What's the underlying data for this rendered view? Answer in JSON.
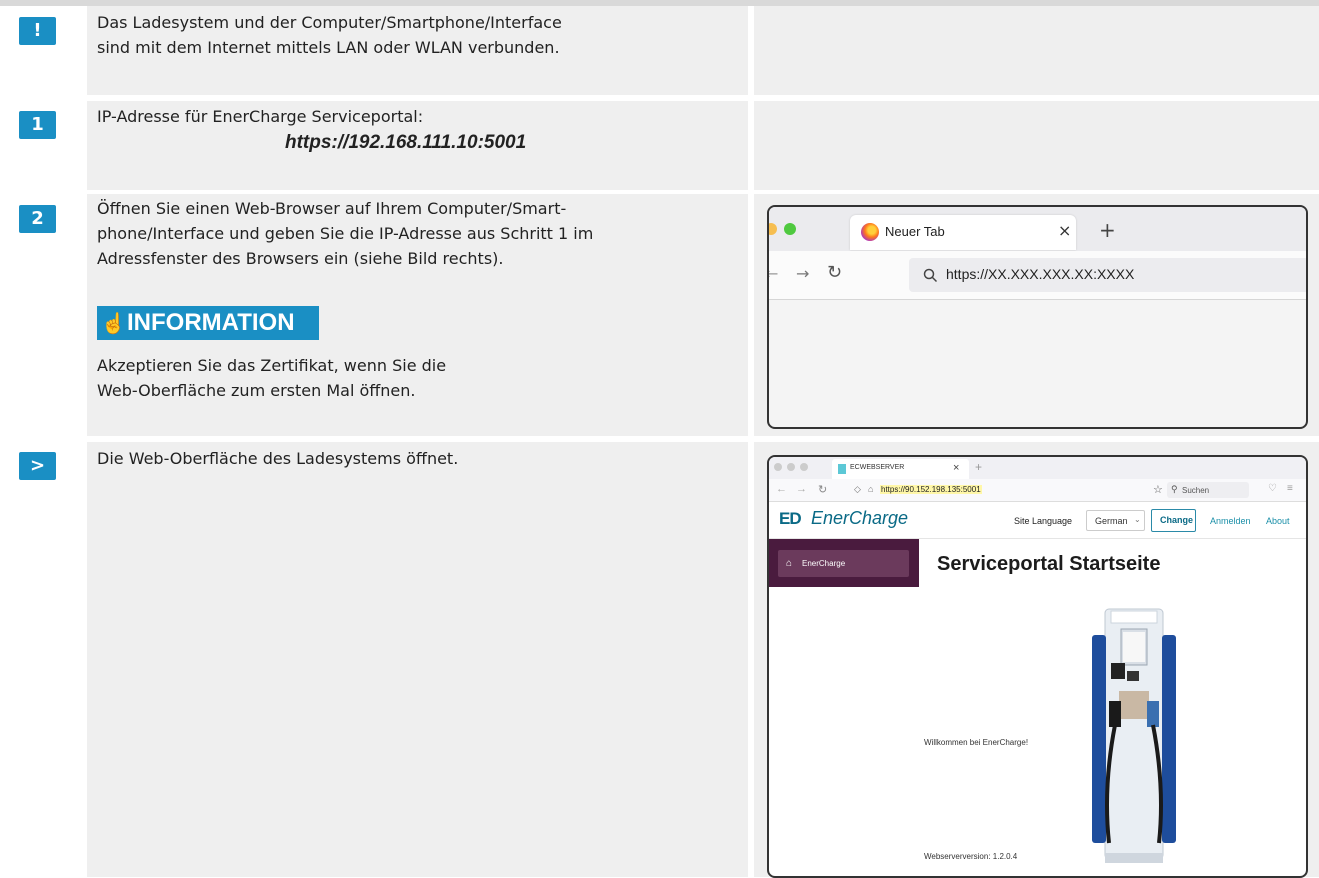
{
  "rows": [
    {
      "badge": "!",
      "lines": [
        "Das Ladesystem und der Computer/Smartphone/Interface",
        "sind mit dem Internet mittels LAN oder WLAN verbunden."
      ]
    },
    {
      "badge": "1",
      "lines": [
        "IP-Adresse für EnerCharge Serviceportal:"
      ],
      "ip": "https://192.168.111.10:5001"
    },
    {
      "badge": "2",
      "lines": [
        "Öffnen Sie einen Web-Browser auf Ihrem Computer/Smart-",
        "phone/Interface und geben Sie die IP-Adresse aus Schritt 1 im",
        "Adressfenster des Browsers ein (siehe Bild rechts)."
      ],
      "info_title": "INFORMATION",
      "info_lines": [
        "Akzeptieren Sie das Zertifikat, wenn Sie die",
        "Web-Oberfläche zum ersten Mal öffnen."
      ]
    },
    {
      "badge": ">",
      "lines": [
        "Die Web-Oberfläche des Ladesystems öffnet."
      ]
    }
  ],
  "browser1": {
    "tab_label": "Neuer Tab",
    "close": "×",
    "new_tab": "+",
    "url": "https://XX.XXX.XXX.XX:XXXX"
  },
  "browser2": {
    "tab_label": "ECWEBSERVER",
    "close": "×",
    "new_tab": "+",
    "url": "https://90.152.198.135:5001",
    "search_placeholder": "Suchen",
    "brand": "EnerCharge",
    "logo_mark": "ED",
    "site_language_label": "Site Language",
    "language_value": "German",
    "change_button": "Change",
    "login_link": "Anmelden",
    "about_link": "About",
    "sidebar_item": "EnerCharge",
    "page_title": "Serviceportal Startseite",
    "welcome": "Willkommen bei EnerCharge!",
    "version": "Webserverversion: 1.2.0.4"
  }
}
